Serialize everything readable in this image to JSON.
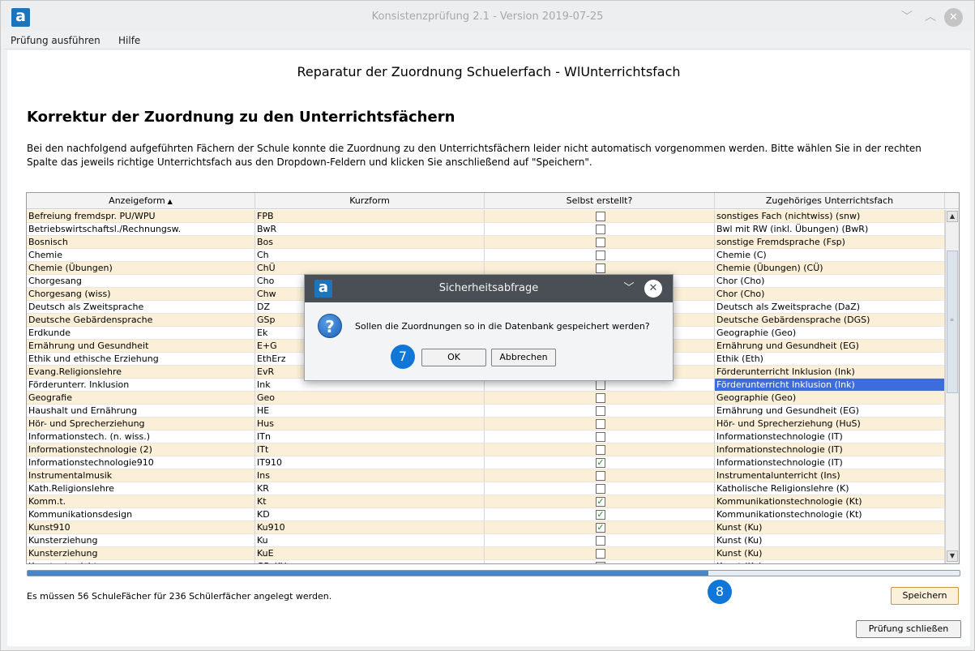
{
  "window": {
    "title": "Konsistenzprüfung 2.1 - Version 2019-07-25",
    "logo_letter": "a",
    "min_glyph": "﹀",
    "max_glyph": "︿",
    "close_glyph": "✕"
  },
  "menu": [
    "Prüfung ausführen",
    "Hilfe"
  ],
  "page": {
    "main_title": "Reparatur der Zuordnung Schuelerfach - WlUnterrichtsfach",
    "section_title": "Korrektur der Zuordnung zu den Unterrichtsfächern",
    "description": "Bei den nachfolgend aufgeführten Fächern der Schule konnte die Zuordnung zu den Unterrichtsfächern leider nicht automatisch vorgenommen werden. Bitte wählen Sie in der rechten Spalte das jeweils richtige Unterrichtsfach aus den Dropdown-Feldern und klicken Sie anschließend auf \"Speichern\"."
  },
  "table": {
    "headers": [
      "Anzeigeform",
      "Kurzform",
      "Selbst erstellt?",
      "Zugehöriges Unterrichtsfach"
    ],
    "sort_indicator": "▲",
    "rows": [
      {
        "anzeige": "Befreiung fremdspr. PU/WPU",
        "kurz": "FPB",
        "selbst": false,
        "fach": "sonstiges Fach (nichtwiss) (snw)"
      },
      {
        "anzeige": "Betriebswirtschaftsl./Rechnungsw.",
        "kurz": "BwR",
        "selbst": false,
        "fach": "Bwl mit RW (inkl. Übungen) (BwR)"
      },
      {
        "anzeige": "Bosnisch",
        "kurz": "Bos",
        "selbst": false,
        "fach": "sonstige Fremdsprache (Fsp)"
      },
      {
        "anzeige": "Chemie",
        "kurz": "Ch",
        "selbst": false,
        "fach": "Chemie (C)"
      },
      {
        "anzeige": "Chemie (Übungen)",
        "kurz": "ChÜ",
        "selbst": false,
        "fach": "Chemie (Übungen) (CÜ)"
      },
      {
        "anzeige": "Chorgesang",
        "kurz": "Cho",
        "selbst": false,
        "fach": "Chor (Cho)"
      },
      {
        "anzeige": "Chorgesang (wiss)",
        "kurz": "Chw",
        "selbst": false,
        "fach": "Chor (Cho)"
      },
      {
        "anzeige": "Deutsch als Zweitsprache",
        "kurz": "DZ",
        "selbst": false,
        "fach": "Deutsch als Zweitsprache (DaZ)"
      },
      {
        "anzeige": "Deutsche Gebärdensprache",
        "kurz": "GSp",
        "selbst": false,
        "fach": "Deutsche Gebärdensprache (DGS)"
      },
      {
        "anzeige": "Erdkunde",
        "kurz": "Ek",
        "selbst": false,
        "fach": "Geographie (Geo)"
      },
      {
        "anzeige": "Ernährung und Gesundheit",
        "kurz": "E+G",
        "selbst": false,
        "fach": "Ernährung und Gesundheit (EG)"
      },
      {
        "anzeige": "Ethik und ethische Erziehung",
        "kurz": "EthErz",
        "selbst": false,
        "fach": "Ethik (Eth)"
      },
      {
        "anzeige": "Evang.Religionslehre",
        "kurz": "EvR",
        "selbst": false,
        "fach": "Förderunterricht Inklusion (Ink)"
      },
      {
        "anzeige": "Förderunterr. Inklusion",
        "kurz": "Ink",
        "selbst": false,
        "fach": "Förderunterricht Inklusion (Ink)",
        "selected": true
      },
      {
        "anzeige": "Geografie",
        "kurz": "Geo",
        "selbst": false,
        "fach": "Geographie (Geo)"
      },
      {
        "anzeige": "Haushalt und Ernährung",
        "kurz": "HE",
        "selbst": false,
        "fach": "Ernährung und Gesundheit (EG)"
      },
      {
        "anzeige": "Hör- und Sprecherziehung",
        "kurz": "Hus",
        "selbst": false,
        "fach": "Hör- und Sprecherziehung (HuS)"
      },
      {
        "anzeige": "Informationstech. (n. wiss.)",
        "kurz": "ITn",
        "selbst": false,
        "fach": "Informationstechnologie (IT)"
      },
      {
        "anzeige": "Informationstechnologie (2)",
        "kurz": "ITt",
        "selbst": false,
        "fach": "Informationstechnologie (IT)"
      },
      {
        "anzeige": "Informationstechnologie910",
        "kurz": "IT910",
        "selbst": true,
        "fach": "Informationstechnologie (IT)"
      },
      {
        "anzeige": "Instrumentalmusik",
        "kurz": "Ins",
        "selbst": false,
        "fach": "Instrumentalunterricht (Ins)"
      },
      {
        "anzeige": "Kath.Religionslehre",
        "kurz": "KR",
        "selbst": false,
        "fach": "Katholische Religionslehre (K)"
      },
      {
        "anzeige": "Komm.t.",
        "kurz": "Kt",
        "selbst": true,
        "fach": "Kommunikationstechnologie (Kt)"
      },
      {
        "anzeige": "Kommunikationsdesign",
        "kurz": "KD",
        "selbst": true,
        "fach": "Kommunikationstechnologie (Kt)"
      },
      {
        "anzeige": "Kunst910",
        "kurz": "Ku910",
        "selbst": true,
        "fach": "Kunst (Ku)"
      },
      {
        "anzeige": "Kunsterziehung",
        "kurz": "Ku",
        "selbst": false,
        "fach": "Kunst (Ku)"
      },
      {
        "anzeige": "Kunsterziehung",
        "kurz": "KuE",
        "selbst": false,
        "fach": "Kunst (Ku)"
      },
      {
        "anzeige": "Kunstunterricht",
        "kurz": "GR_KU",
        "selbst": false,
        "fach": "Kunst (Ku)"
      }
    ]
  },
  "progress": {
    "fraction": 0.73
  },
  "status_text": "Es müssen 56 SchuleFächer für 236 Schülerfächer angelegt werden.",
  "buttons": {
    "save": "Speichern",
    "close_check": "Prüfung schließen"
  },
  "badges": {
    "ok_badge": "7",
    "progress_badge": "8"
  },
  "dialog": {
    "title": "Sicherheitsabfrage",
    "message": "Sollen die Zuordnungen so in die Datenbank gespeichert werden?",
    "ok": "OK",
    "cancel": "Abbrechen",
    "icon_glyph": "?",
    "min_glyph": "﹀",
    "close_glyph": "✕"
  },
  "colors": {
    "row_alt": "#fbf0d7",
    "selection": "#3b6ddc",
    "dialog_titlebar": "#4a4f55",
    "badge": "#1077d8",
    "brand": "#1c74bb"
  }
}
